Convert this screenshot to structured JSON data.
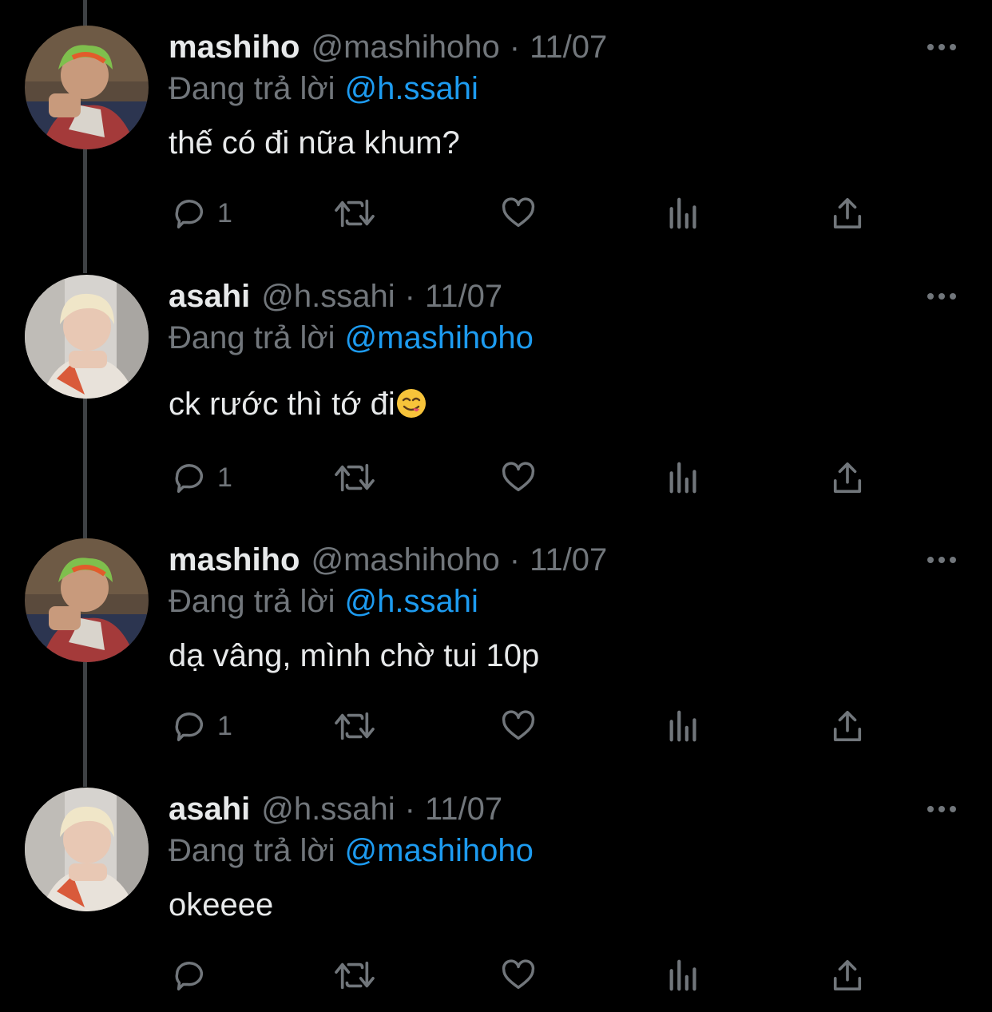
{
  "reply_prefix": "Đang trả lời",
  "colors": {
    "background": "#000000",
    "text": "#e7e9ea",
    "muted": "#71767b",
    "link": "#1d9bf0",
    "thread_line": "#3e4144"
  },
  "tweets": [
    {
      "name": "mashiho",
      "handle": "@mashihoho",
      "separator": "·",
      "date": "11/07",
      "replying_to": "@h.ssahi",
      "text": "thế có đi nữa khum?",
      "emoji": "",
      "reply_count": "1",
      "avatar": "avatar-mashiho"
    },
    {
      "name": "asahi",
      "handle": "@h.ssahi",
      "separator": "·",
      "date": "11/07",
      "replying_to": "@mashihoho",
      "text": "ck rước thì tớ đi",
      "emoji": "face-savoring-food-emoji",
      "reply_count": "1",
      "avatar": "avatar-asahi"
    },
    {
      "name": "mashiho",
      "handle": "@mashihoho",
      "separator": "·",
      "date": "11/07",
      "replying_to": "@h.ssahi",
      "text": "dạ vâng, mình chờ tui 10p",
      "emoji": "",
      "reply_count": "1",
      "avatar": "avatar-mashiho"
    },
    {
      "name": "asahi",
      "handle": "@h.ssahi",
      "separator": "·",
      "date": "11/07",
      "replying_to": "@mashihoho",
      "text": "okeeee",
      "emoji": "",
      "reply_count": "",
      "avatar": "avatar-asahi"
    }
  ]
}
